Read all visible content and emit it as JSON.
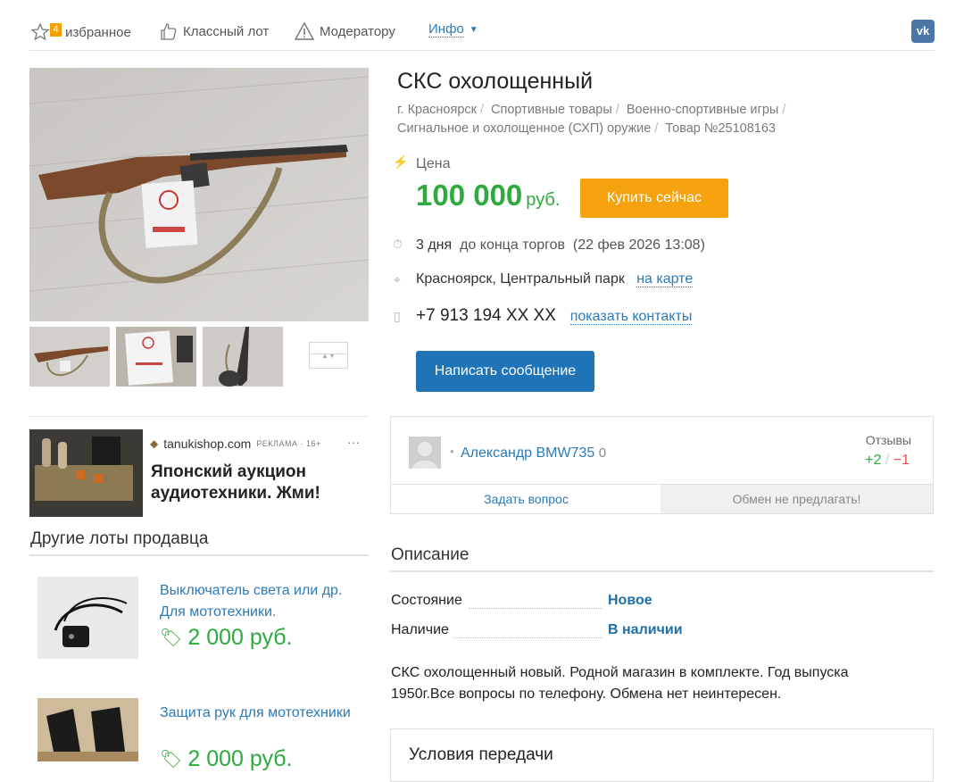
{
  "topbar": {
    "favorites_badge": "4",
    "favorites_label": "В избранное",
    "classy_label": "Классный лот",
    "moderator_label": "Модератору",
    "info_label": "Инфо",
    "vk_label": "vk"
  },
  "lot": {
    "title": "СКС охолощенный",
    "breadcrumbs": [
      "г. Красноярск",
      "Спортивные товары",
      "Военно-спортивные игры",
      "Сигнальное и охолощенное (СХП) оружие",
      "Товар №25108163"
    ],
    "price_label": "Цена",
    "price_value": "100 000",
    "price_currency": "руб.",
    "buy_label": "Купить сейчас",
    "time_bold": "3 дня",
    "time_rest": "до конца торгов",
    "time_date": "(22 фев 2026 13:08)",
    "location": "Красноярск, Центральный парк",
    "map_link": "на карте",
    "phone": "+7 913 194 XX XX",
    "contacts_link": "показать контакты",
    "message_button": "Написать сообщение"
  },
  "ad": {
    "domain": "tanukishop.com",
    "tag": "РЕКЛАМА · 16+",
    "more": "···",
    "text": "Японский аукцион аудиотехники. Жми!"
  },
  "seller": {
    "name": "Александр BMW735",
    "rating": "0",
    "reviews_label": "Отзывы",
    "positive": "+2",
    "sep": "/",
    "negative": "−1",
    "ask_label": "Задать вопрос",
    "no_exchange_label": "Обмен не предлагать!"
  },
  "other_lots": {
    "heading": "Другие лоты продавца",
    "items": [
      {
        "title": "Выключатель света или др. Для мототехники.",
        "price": "2 000 руб."
      },
      {
        "title": "Защита рук для мототехники",
        "price": "2 000 руб."
      }
    ]
  },
  "description": {
    "heading": "Описание",
    "condition_label": "Состояние",
    "condition_value": "Новое",
    "availability_label": "Наличие",
    "availability_value": "В наличии",
    "text": "СКС охолощенный новый. Родной магазин в комплекте. Год выпуска 1950г.Все вопросы по телефону. Обмена нет неинтересен."
  },
  "delivery": {
    "heading": "Условия передачи"
  },
  "colors": {
    "price_green": "#2eaa3f",
    "buy_orange": "#f6a20f",
    "link_blue": "#2a7ab8",
    "button_blue": "#1f73b7"
  }
}
